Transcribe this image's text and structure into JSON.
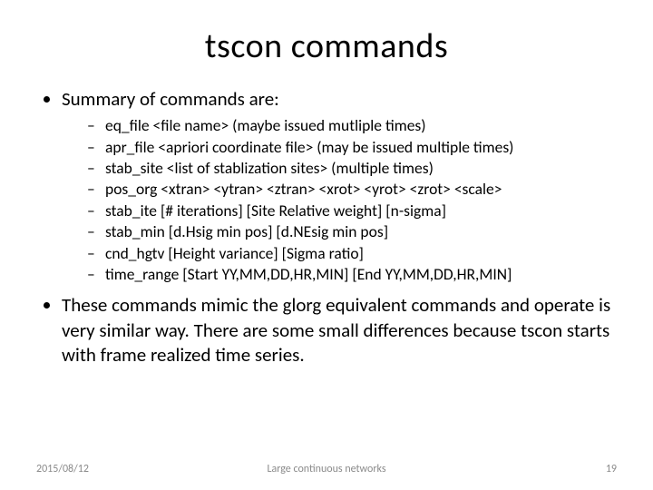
{
  "title": "tscon commands",
  "bullets": {
    "summary_label": "Summary of commands are:",
    "items": [
      " eq_file <file name>  (maybe issued mutliple times)",
      "apr_file <apriori coordinate file> (may be issued multiple times)",
      "stab_site <list of stablization sites> (multiple times)",
      "pos_org <xtran> <ytran> <ztran> <xrot> <yrot> <zrot> <scale>",
      "stab_ite [# iterations] [Site Relative weight] [n-sigma]",
      "stab_min [d.Hsig min pos] [d.NEsig min pos]",
      "cnd_hgtv [Height variance] [Sigma ratio]",
      "time_range [Start YY,MM,DD,HR,MIN] [End YY,MM,DD,HR,MIN]"
    ],
    "para": "These commands mimic the glorg equivalent commands and operate is very similar way.  There are some small differences because tscon starts with frame realized time series."
  },
  "footer": {
    "date": "2015/08/12",
    "center": "Large continuous networks",
    "page": "19"
  }
}
